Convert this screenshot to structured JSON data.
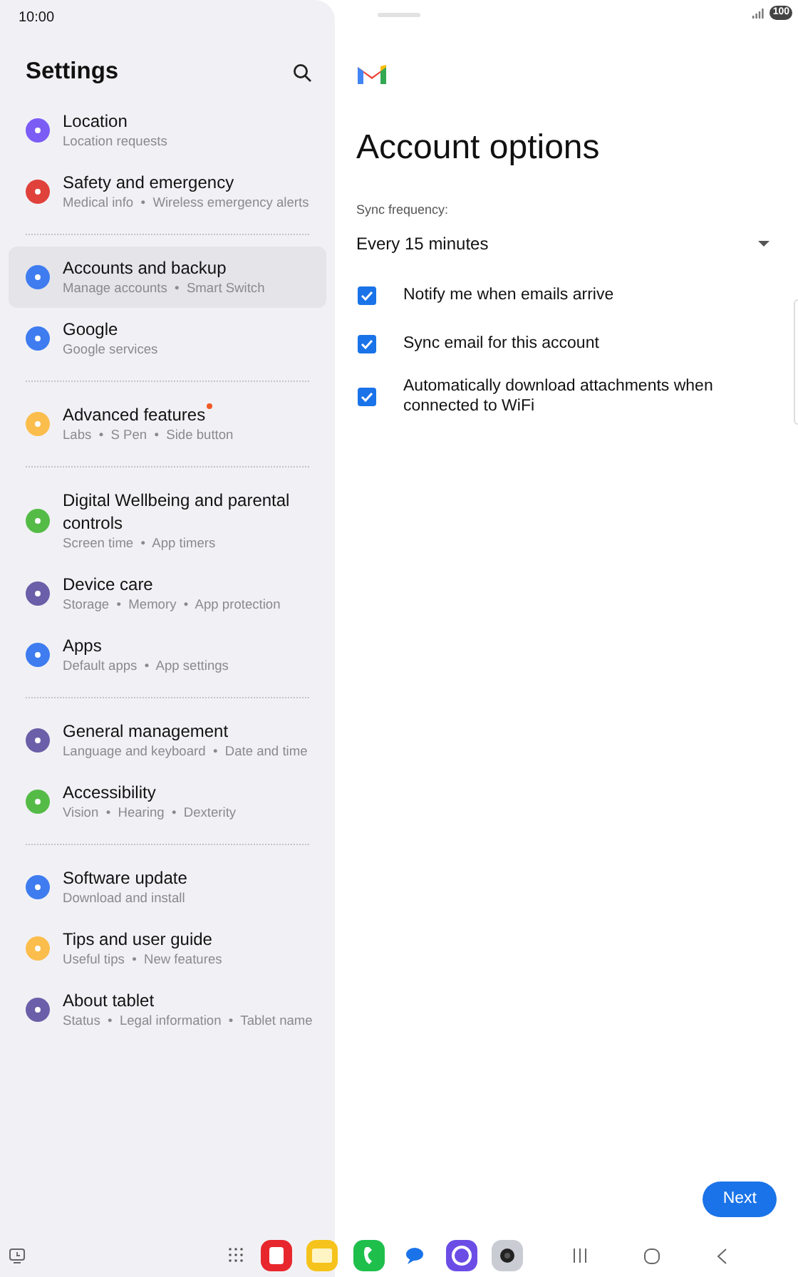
{
  "status_bar": {
    "time": "10:00",
    "battery": "100"
  },
  "sidebar": {
    "title": "Settings",
    "groups": [
      {
        "items": [
          {
            "title": "Location",
            "subtitle": "Location requests",
            "color": "#7b5cf5",
            "selected": false,
            "new_dot": false
          },
          {
            "title": "Safety and emergency",
            "subtitle": "Medical info  •  Wireless emergency alerts",
            "color": "#e0413b",
            "selected": false,
            "new_dot": false
          }
        ]
      },
      {
        "items": [
          {
            "title": "Accounts and backup",
            "subtitle": "Manage accounts  •  Smart Switch",
            "color": "#3e7cf0",
            "selected": true,
            "new_dot": false
          },
          {
            "title": "Google",
            "subtitle": "Google services",
            "color": "#3e7cf0",
            "selected": false,
            "new_dot": false
          }
        ]
      },
      {
        "items": [
          {
            "title": "Advanced features",
            "subtitle": "Labs  •  S Pen  •  Side button",
            "color": "#fbbd4c",
            "selected": false,
            "new_dot": true
          }
        ]
      },
      {
        "items": [
          {
            "title": "Digital Wellbeing and parental controls",
            "subtitle": "Screen time  •  App timers",
            "color": "#55bb47",
            "selected": false,
            "new_dot": false
          },
          {
            "title": "Device care",
            "subtitle": "Storage  •  Memory  •  App protection",
            "color": "#6a5fa8",
            "selected": false,
            "new_dot": false
          },
          {
            "title": "Apps",
            "subtitle": "Default apps  •  App settings",
            "color": "#3e7cf0",
            "selected": false,
            "new_dot": false
          }
        ]
      },
      {
        "items": [
          {
            "title": "General management",
            "subtitle": "Language and keyboard  •  Date and time",
            "color": "#6a5fa8",
            "selected": false,
            "new_dot": false
          },
          {
            "title": "Accessibility",
            "subtitle": "Vision  •  Hearing  •  Dexterity",
            "color": "#55bb47",
            "selected": false,
            "new_dot": false
          }
        ]
      },
      {
        "items": [
          {
            "title": "Software update",
            "subtitle": "Download and install",
            "color": "#3e7cf0",
            "selected": false,
            "new_dot": false
          },
          {
            "title": "Tips and user guide",
            "subtitle": "Useful tips  •  New features",
            "color": "#fbbd4c",
            "selected": false,
            "new_dot": false
          },
          {
            "title": "About tablet",
            "subtitle": "Status  •  Legal information  •  Tablet name",
            "color": "#6a5fa8",
            "selected": false,
            "new_dot": false
          }
        ]
      }
    ]
  },
  "account_options": {
    "title": "Account options",
    "sync_label": "Sync frequency:",
    "sync_value": "Every 15 minutes",
    "options": [
      {
        "label": "Notify me when emails arrive",
        "checked": true
      },
      {
        "label": "Sync email for this account",
        "checked": true
      },
      {
        "label": "Automatically download attachments when connected to WiFi",
        "checked": true
      }
    ],
    "next_button": "Next"
  },
  "taskbar": {
    "apps": [
      {
        "kind": "notes",
        "color": "#e8262d"
      },
      {
        "kind": "files",
        "color": "#f5c31b"
      },
      {
        "kind": "phone",
        "color": "#1fbf4c"
      },
      {
        "kind": "messages",
        "color": "#1a73e8"
      },
      {
        "kind": "internet",
        "color": "#6b4de6"
      },
      {
        "kind": "camera",
        "color": "#c9ccd3"
      }
    ]
  }
}
